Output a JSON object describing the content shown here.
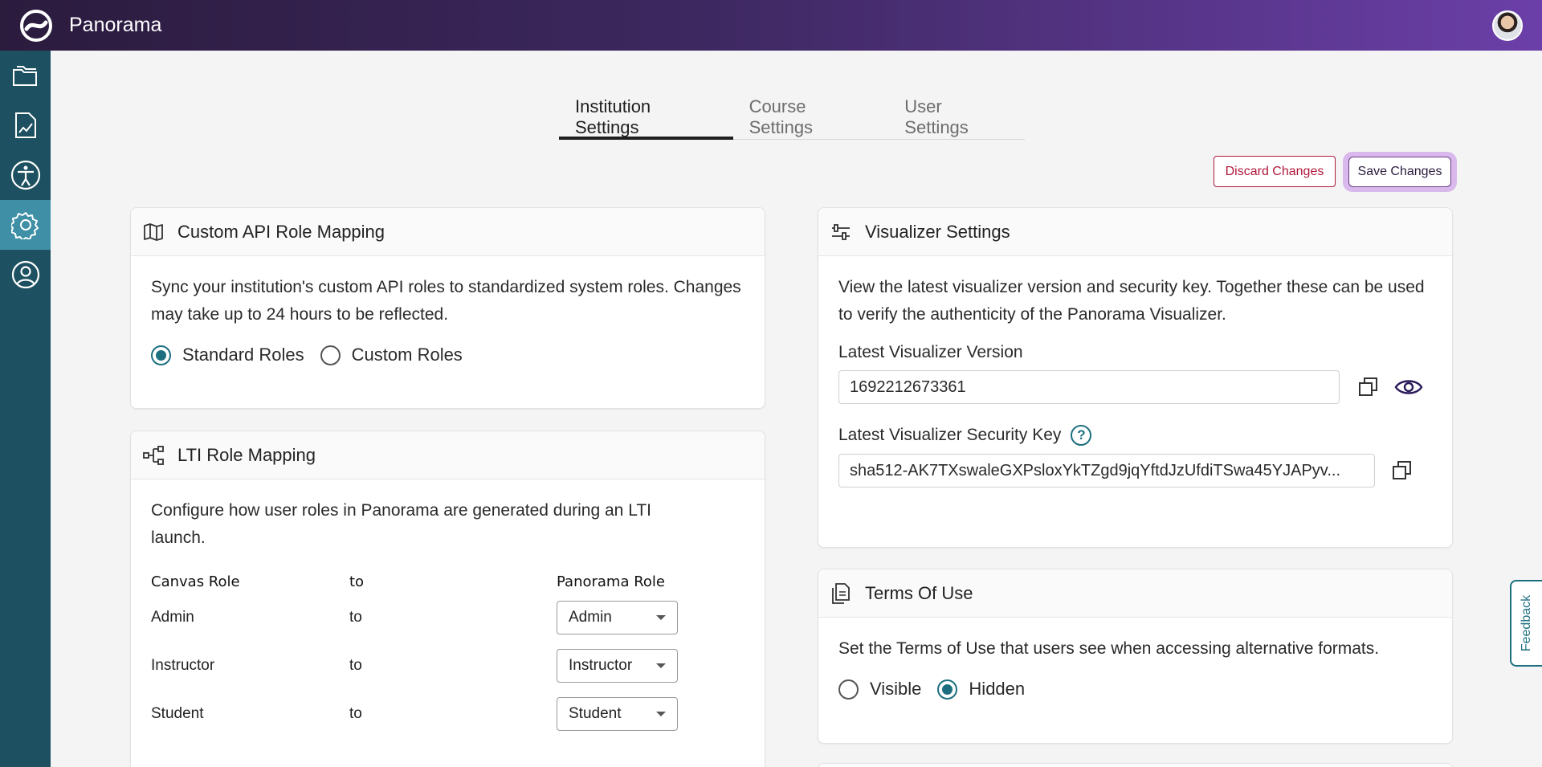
{
  "app": {
    "name": "Panorama"
  },
  "tabs": [
    {
      "label": "Institution Settings",
      "active": true
    },
    {
      "label": "Course Settings",
      "active": false
    },
    {
      "label": "User Settings",
      "active": false
    }
  ],
  "actions": {
    "discard": "Discard Changes",
    "save": "Save Changes"
  },
  "sidebar": {
    "items": [
      {
        "icon": "folders-icon"
      },
      {
        "icon": "report-chart-icon"
      },
      {
        "icon": "accessibility-icon"
      },
      {
        "icon": "gear-icon",
        "active": true
      },
      {
        "icon": "user-circle-icon"
      }
    ]
  },
  "custom_api": {
    "title": "Custom API Role Mapping",
    "description": "Sync your institution's custom API roles to standardized system roles. Changes may take up to 24 hours to be reflected.",
    "options": [
      "Standard Roles",
      "Custom Roles"
    ],
    "selected": "Standard Roles"
  },
  "lti": {
    "title": "LTI Role Mapping",
    "description": "Configure how user roles in Panorama are generated during an LTI launch.",
    "headers": {
      "canvas": "Canvas Role",
      "to": "to",
      "panorama": "Panorama Role"
    },
    "rows": [
      {
        "canvas": "Admin",
        "to": "to",
        "panorama": "Admin"
      },
      {
        "canvas": "Instructor",
        "to": "to",
        "panorama": "Instructor"
      },
      {
        "canvas": "Student",
        "to": "to",
        "panorama": "Student"
      }
    ]
  },
  "visualizer": {
    "title": "Visualizer Settings",
    "description": "View the latest visualizer version and security key. Together these can be used to verify the authenticity of the Panorama Visualizer.",
    "version_label": "Latest Visualizer Version",
    "version_value": "1692212673361",
    "key_label": "Latest Visualizer Security Key",
    "key_value": "sha512-AK7TXswaleGXPsloxYkTZgd9jqYftdJzUfdiTSwa45YJAPyv..."
  },
  "terms": {
    "title": "Terms Of Use",
    "description": "Set the Terms of Use that users see when accessing alternative formats.",
    "options": [
      "Visible",
      "Hidden"
    ],
    "selected": "Hidden"
  },
  "feedback": {
    "label": "Feedback"
  },
  "colors": {
    "sidebar": "#1d5060",
    "sidebar_active": "#3f8fa6",
    "accent": "#1d6f80",
    "discard": "#b0173a"
  }
}
